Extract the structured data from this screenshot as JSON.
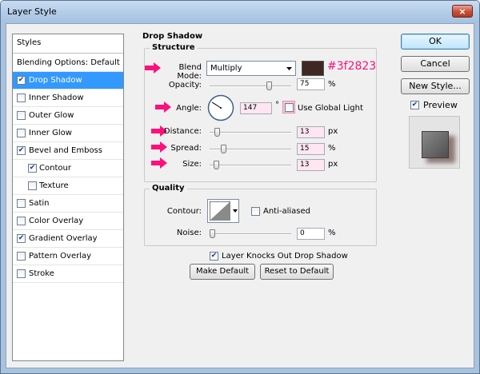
{
  "window": {
    "title": "Layer Style",
    "close_glyph": "×"
  },
  "styles_list": {
    "header": "Styles",
    "items": [
      {
        "label": "Blending Options: Default",
        "has_checkbox": false,
        "checked": false,
        "active": false,
        "sub": false
      },
      {
        "label": "Drop Shadow",
        "has_checkbox": true,
        "checked": true,
        "active": true,
        "sub": false
      },
      {
        "label": "Inner Shadow",
        "has_checkbox": true,
        "checked": false,
        "active": false,
        "sub": false
      },
      {
        "label": "Outer Glow",
        "has_checkbox": true,
        "checked": false,
        "active": false,
        "sub": false
      },
      {
        "label": "Inner Glow",
        "has_checkbox": true,
        "checked": false,
        "active": false,
        "sub": false
      },
      {
        "label": "Bevel and Emboss",
        "has_checkbox": true,
        "checked": true,
        "active": false,
        "sub": false
      },
      {
        "label": "Contour",
        "has_checkbox": true,
        "checked": true,
        "active": false,
        "sub": true
      },
      {
        "label": "Texture",
        "has_checkbox": true,
        "checked": false,
        "active": false,
        "sub": true
      },
      {
        "label": "Satin",
        "has_checkbox": true,
        "checked": false,
        "active": false,
        "sub": false
      },
      {
        "label": "Color Overlay",
        "has_checkbox": true,
        "checked": false,
        "active": false,
        "sub": false
      },
      {
        "label": "Gradient Overlay",
        "has_checkbox": true,
        "checked": true,
        "active": false,
        "sub": false
      },
      {
        "label": "Pattern Overlay",
        "has_checkbox": true,
        "checked": false,
        "active": false,
        "sub": false
      },
      {
        "label": "Stroke",
        "has_checkbox": true,
        "checked": false,
        "active": false,
        "sub": false
      }
    ]
  },
  "drop_shadow": {
    "group_title": "Drop Shadow",
    "structure_title": "Structure",
    "blend_mode": {
      "label": "Blend Mode:",
      "value": "Multiply",
      "color_hex_text": "#3f2823",
      "color": "#3f2823"
    },
    "opacity": {
      "label": "Opacity:",
      "value": "75",
      "unit": "%",
      "slider_fraction": 0.75
    },
    "angle": {
      "label": "Angle:",
      "value": "147",
      "unit": "°",
      "degrees": 147,
      "global_light_label": "Use Global Light",
      "global_light_checked": false
    },
    "distance": {
      "label": "Distance:",
      "value": "13",
      "unit": "px",
      "slider_fraction": 0.06
    },
    "spread": {
      "label": "Spread:",
      "value": "15",
      "unit": "%",
      "slider_fraction": 0.15
    },
    "size": {
      "label": "Size:",
      "value": "13",
      "unit": "px",
      "slider_fraction": 0.05
    },
    "quality_title": "Quality",
    "contour": {
      "label": "Contour:",
      "anti_aliased_label": "Anti-aliased",
      "anti_aliased_checked": false
    },
    "noise": {
      "label": "Noise:",
      "value": "0",
      "unit": "%",
      "slider_fraction": 0.0
    },
    "knocks_out_label": "Layer Knocks Out Drop Shadow",
    "knocks_out_checked": true,
    "make_default_label": "Make Default",
    "reset_default_label": "Reset to Default"
  },
  "right_panel": {
    "ok_label": "OK",
    "cancel_label": "Cancel",
    "new_style_label": "New Style...",
    "preview_label": "Preview",
    "preview_checked": true
  },
  "colors": {
    "annotation_pink": "#ff0f7b",
    "selection_blue": "#3399ff"
  },
  "icons": {
    "annotation_arrow": "pink-arrow-icon",
    "dropdown": "chevron-down-icon",
    "check": "checkmark-icon"
  }
}
